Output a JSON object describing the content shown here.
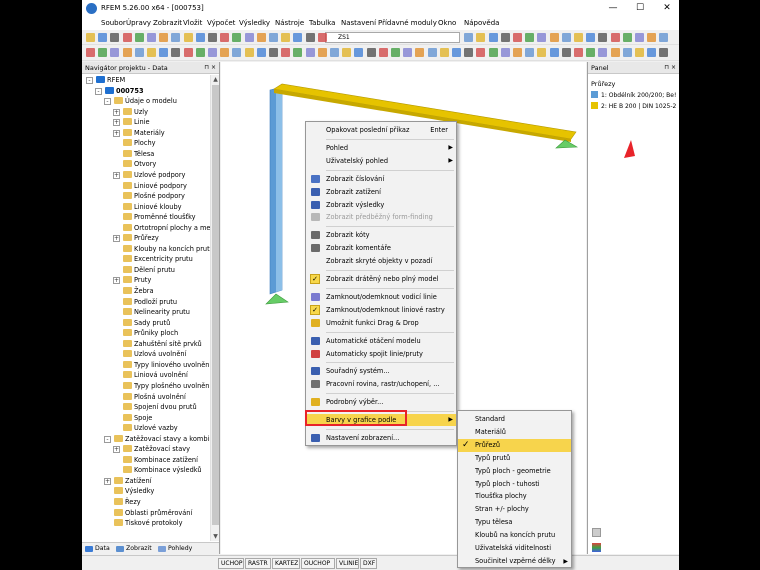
{
  "window": {
    "title": "RFEM 5.26.00 x64 - [000753]",
    "min": "—",
    "max": "☐",
    "close": "✕"
  },
  "menu": [
    "Soubor",
    "Úpravy",
    "Zobrazit",
    "Vložit",
    "Výpočet",
    "Výsledky",
    "Nástroje",
    "Tabulka",
    "Nastavení",
    "Přídavné moduly",
    "Okno",
    "Nápověda"
  ],
  "toolbar": {
    "loadcase_value": "ZS1"
  },
  "navigator": {
    "title": "Navigátor projektu - Data",
    "pin": "⊓ ×",
    "tree": [
      {
        "label": "RFEM",
        "level": 0,
        "exp": "-",
        "color": "#1e6fd0"
      },
      {
        "label": "000753",
        "level": 1,
        "exp": "-",
        "color": "#1e6fd0",
        "bold": true
      },
      {
        "label": "Údaje o modelu",
        "level": 2,
        "exp": "-",
        "color": "#e9c25a"
      },
      {
        "label": "Uzly",
        "level": 3,
        "exp": "+",
        "color": "#e9c25a"
      },
      {
        "label": "Linie",
        "level": 3,
        "exp": "+",
        "color": "#e9c25a"
      },
      {
        "label": "Materiály",
        "level": 3,
        "exp": "+",
        "color": "#e9c25a"
      },
      {
        "label": "Plochy",
        "level": 3,
        "exp": "",
        "color": "#e9c25a"
      },
      {
        "label": "Tělesa",
        "level": 3,
        "exp": "",
        "color": "#e9c25a"
      },
      {
        "label": "Otvory",
        "level": 3,
        "exp": "",
        "color": "#e9c25a"
      },
      {
        "label": "Uzlové podpory",
        "level": 3,
        "exp": "+",
        "color": "#e9c25a"
      },
      {
        "label": "Liniové podpory",
        "level": 3,
        "exp": "",
        "color": "#e9c25a"
      },
      {
        "label": "Plošné podpory",
        "level": 3,
        "exp": "",
        "color": "#e9c25a"
      },
      {
        "label": "Liniové klouby",
        "level": 3,
        "exp": "",
        "color": "#e9c25a"
      },
      {
        "label": "Proměnné tloušťky",
        "level": 3,
        "exp": "",
        "color": "#e9c25a"
      },
      {
        "label": "Ortotropní plochy a mem",
        "level": 3,
        "exp": "",
        "color": "#e9c25a"
      },
      {
        "label": "Průřezy",
        "level": 3,
        "exp": "+",
        "color": "#e9c25a"
      },
      {
        "label": "Klouby na koncích prutu",
        "level": 3,
        "exp": "",
        "color": "#e9c25a"
      },
      {
        "label": "Excentricity prutu",
        "level": 3,
        "exp": "",
        "color": "#e9c25a"
      },
      {
        "label": "Dělení prutu",
        "level": 3,
        "exp": "",
        "color": "#e9c25a"
      },
      {
        "label": "Pruty",
        "level": 3,
        "exp": "+",
        "color": "#e9c25a"
      },
      {
        "label": "Žebra",
        "level": 3,
        "exp": "",
        "color": "#e9c25a"
      },
      {
        "label": "Podloží prutu",
        "level": 3,
        "exp": "",
        "color": "#e9c25a"
      },
      {
        "label": "Nelinearity prutu",
        "level": 3,
        "exp": "",
        "color": "#e9c25a"
      },
      {
        "label": "Sady prutů",
        "level": 3,
        "exp": "",
        "color": "#e9c25a"
      },
      {
        "label": "Průniky ploch",
        "level": 3,
        "exp": "",
        "color": "#e9c25a"
      },
      {
        "label": "Zahuštění sítě prvků",
        "level": 3,
        "exp": "",
        "color": "#e9c25a"
      },
      {
        "label": "Uzlová uvolnění",
        "level": 3,
        "exp": "",
        "color": "#e9c25a"
      },
      {
        "label": "Typy liniového uvolnění",
        "level": 3,
        "exp": "",
        "color": "#e9c25a"
      },
      {
        "label": "Liniová uvolnění",
        "level": 3,
        "exp": "",
        "color": "#e9c25a"
      },
      {
        "label": "Typy plošného uvolnění",
        "level": 3,
        "exp": "",
        "color": "#e9c25a"
      },
      {
        "label": "Plošná uvolnění",
        "level": 3,
        "exp": "",
        "color": "#e9c25a"
      },
      {
        "label": "Spojení dvou prutů",
        "level": 3,
        "exp": "",
        "color": "#e9c25a"
      },
      {
        "label": "Spoje",
        "level": 3,
        "exp": "",
        "color": "#e9c25a"
      },
      {
        "label": "Uzlové vazby",
        "level": 3,
        "exp": "",
        "color": "#e9c25a"
      },
      {
        "label": "Zatěžovací stavy a kombinac",
        "level": 2,
        "exp": "-",
        "color": "#e9c25a"
      },
      {
        "label": "Zatěžovací stavy",
        "level": 3,
        "exp": "+",
        "color": "#e9c25a"
      },
      {
        "label": "Kombinace zatížení",
        "level": 3,
        "exp": "",
        "color": "#e9c25a"
      },
      {
        "label": "Kombinace výsledků",
        "level": 3,
        "exp": "",
        "color": "#e9c25a"
      },
      {
        "label": "Zatížení",
        "level": 2,
        "exp": "+",
        "color": "#e9c25a"
      },
      {
        "label": "Výsledky",
        "level": 2,
        "exp": "",
        "color": "#e9c25a"
      },
      {
        "label": "Řezy",
        "level": 2,
        "exp": "",
        "color": "#e9c25a"
      },
      {
        "label": "Oblasti průměrování",
        "level": 2,
        "exp": "",
        "color": "#e9c25a"
      },
      {
        "label": "Tiskové protokoly",
        "level": 2,
        "exp": "",
        "color": "#e9c25a"
      }
    ],
    "tabs": [
      "Data",
      "Zobrazit",
      "Pohledy"
    ]
  },
  "panel": {
    "title": "Panel",
    "pin": "⊓ ×",
    "heading": "Průřezy",
    "legend": [
      {
        "label": "1: Obdélník 200/200; Be!",
        "color": "#5b9bd5"
      },
      {
        "label": "2: HE B 200 | DIN 1025-2",
        "color": "#e6c300"
      }
    ]
  },
  "statusbar": [
    "UCHOP",
    "RASTR",
    "KARTEZ",
    "OUCHOP",
    "VLINIE",
    "DXF"
  ],
  "context_menu": [
    {
      "label": "Opakovat poslední příkaz",
      "shortcut": "Enter",
      "arrow": "",
      "disabled": false,
      "icon": "",
      "check": false
    },
    {
      "sep": true
    },
    {
      "label": "Pohled",
      "arrow": "▶",
      "disabled": false,
      "icon": "",
      "check": false
    },
    {
      "label": "Uživatelský pohled",
      "arrow": "▶",
      "disabled": false,
      "icon": "",
      "check": false
    },
    {
      "sep": true
    },
    {
      "label": "Zobrazit číslování",
      "icon": "#4a72c4"
    },
    {
      "label": "Zobrazit zatížení",
      "icon": "#3a5fb0"
    },
    {
      "label": "Zobrazit výsledky",
      "icon": "#3a5fb0"
    },
    {
      "label": "Zobrazit předběžný form-finding",
      "icon": "#b8b8b8",
      "disabled": true
    },
    {
      "sep": true
    },
    {
      "label": "Zobrazit kóty",
      "icon": "#6b6b6b"
    },
    {
      "label": "Zobrazit komentáře",
      "icon": "#6b6b6b"
    },
    {
      "label": "Zobrazit skryté objekty v pozadí",
      "icon": ""
    },
    {
      "sep": true
    },
    {
      "label": "Zobrazit drátěný nebo plný model",
      "check": true
    },
    {
      "sep": true
    },
    {
      "label": "Zamknout/odemknout vodicí linie",
      "icon": "#7a7ad0"
    },
    {
      "label": "Zamknout/odemknout liniové rastry",
      "check": true
    },
    {
      "label": "Umožnit funkci Drag & Drop",
      "icon": "#e0b020"
    },
    {
      "sep": true
    },
    {
      "label": "Automatické otáčení modelu",
      "icon": "#3a5fb0"
    },
    {
      "label": "Automaticky spojit linie/pruty",
      "icon": "#d04040"
    },
    {
      "sep": true
    },
    {
      "label": "Souřadný systém...",
      "icon": "#3a5fb0"
    },
    {
      "label": "Pracovní rovina, rastr/uchopení, ...",
      "icon": "#707070"
    },
    {
      "sep": true
    },
    {
      "label": "Podrobný výběr...",
      "icon": "#e0b020"
    },
    {
      "sep": true
    },
    {
      "label": "Barvy v grafice podle",
      "arrow": "▶",
      "highlight": true
    },
    {
      "sep": true
    },
    {
      "label": "Nastavení zobrazení...",
      "icon": "#3a5fb0"
    }
  ],
  "submenu": [
    {
      "label": "Standard"
    },
    {
      "label": "Materiálů"
    },
    {
      "label": "Průřezů",
      "check": true,
      "highlight": true
    },
    {
      "label": "Typů prutů"
    },
    {
      "label": "Typů ploch - geometrie"
    },
    {
      "label": "Typů ploch - tuhosti"
    },
    {
      "label": "Tloušťka plochy"
    },
    {
      "label": "Stran +/- plochy"
    },
    {
      "label": "Typu tělesa"
    },
    {
      "label": "Kloubů na koncích prutu"
    },
    {
      "label": "Uživatelská viditelnosti"
    },
    {
      "label": "Součinitel vzpěrné délky",
      "arrow": "▶"
    }
  ],
  "colors": {
    "highlight": "#f7d44c",
    "annotation_red": "#e8232a",
    "column_blue": "#5b9bd5",
    "beam_yellow": "#e6c300",
    "support_green": "#66cc66"
  }
}
